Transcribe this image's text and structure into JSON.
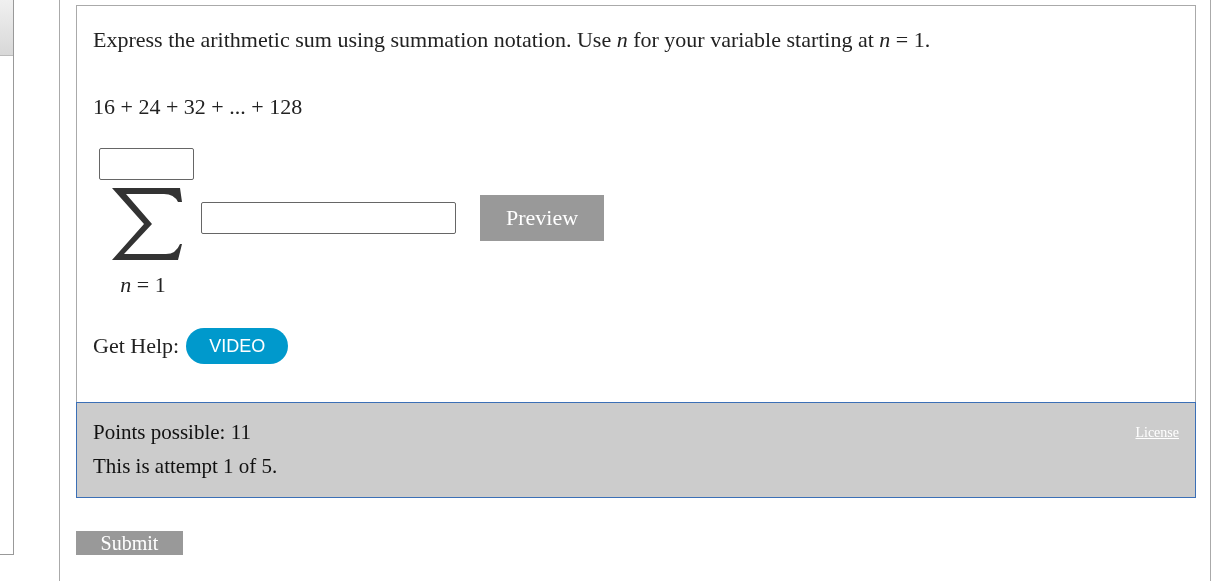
{
  "question": {
    "prompt": "Express the arithmetic sum using summation notation. Use *n* for your variable starting at *n* = 1.",
    "series": "16 + 24 + 32 + ... + 128",
    "summation": {
      "lower_limit": "*n* = 1"
    },
    "preview_button": "Preview",
    "help_label": "Get Help:",
    "help_buttons": [
      "VIDEO"
    ]
  },
  "footer": {
    "points": "Points possible: 11",
    "attempt": "This is attempt 1 of 5.",
    "license": "License"
  },
  "submit_button": "Submit"
}
